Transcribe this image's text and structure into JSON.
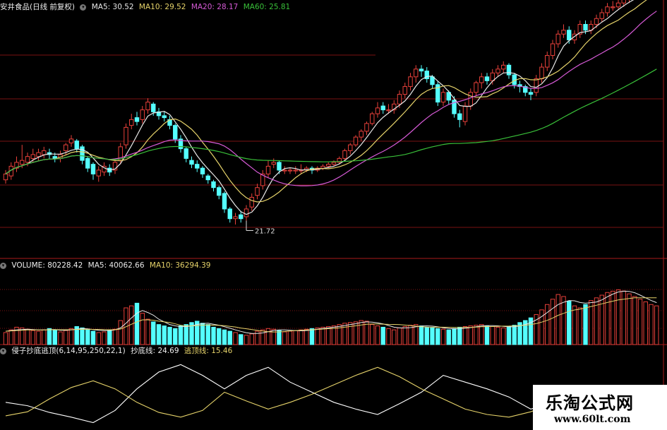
{
  "colors": {
    "up": "#e8403a",
    "down": "#54ffff",
    "ma5": "#e8e8e8",
    "ma10": "#e6d36a",
    "ma20": "#d65ad6",
    "ma60": "#39c039",
    "grid": "#7a1212",
    "frame": "#aa1a1a",
    "osc1": "#ffffff",
    "osc2": "#e6d36a"
  },
  "header_price": {
    "title": "安井食品(日线 前复权)",
    "ma5": "MA5: 30.52",
    "ma10": "MA10: 29.52",
    "ma20": "MA20: 28.17",
    "ma60": "MA60: 25.81"
  },
  "header_volume": {
    "volume": "VOLUME: 80228.42",
    "ma5": "MA5: 40062.66",
    "ma10": "MA10: 36294.39"
  },
  "header_indicator": {
    "title": "侵子抄底逃顶(6,14,95,250,22,1)",
    "buy": "抄底线: 24.69",
    "sell": "逃顶线: 15.46"
  },
  "watermark": {
    "title": "乐淘公式网",
    "url": "www.60lt.com"
  },
  "chart_data": [
    {
      "type": "candlestick",
      "panel": "price",
      "title": "安井食品(日线 前复权)",
      "annotation": "21.72",
      "annotation_x": 44,
      "ylim": [
        20.5,
        33
      ],
      "x": [
        0,
        1,
        2,
        3,
        4,
        5,
        6,
        7,
        8,
        9,
        10,
        11,
        12,
        13,
        14,
        15,
        16,
        17,
        18,
        19,
        20,
        21,
        22,
        23,
        24,
        25,
        26,
        27,
        28,
        29,
        30,
        31,
        32,
        33,
        34,
        35,
        36,
        37,
        38,
        39,
        40,
        41,
        42,
        43,
        44,
        45,
        46,
        47,
        48,
        49,
        50,
        51,
        52,
        53,
        54,
        55,
        56,
        57,
        58,
        59,
        60,
        61,
        62,
        63,
        64,
        65,
        66,
        67,
        68,
        69,
        70,
        71,
        72,
        73,
        74,
        75,
        76,
        77,
        78,
        79,
        80,
        81,
        82,
        83,
        84,
        85,
        86,
        87,
        88,
        89,
        90,
        91,
        92,
        93,
        94,
        95,
        96,
        97,
        98,
        99,
        100,
        101,
        102,
        103,
        104,
        105,
        106,
        107,
        108,
        109,
        110,
        111,
        112,
        113,
        114,
        115,
        116,
        117,
        118,
        119
      ],
      "open": [
        24.4,
        24.6,
        25.0,
        25.2,
        25.3,
        25.5,
        25.6,
        25.7,
        25.8,
        25.6,
        25.5,
        25.9,
        26.3,
        26.4,
        26.1,
        25.5,
        25.2,
        24.6,
        24.8,
        25.0,
        24.9,
        25.4,
        26.2,
        27.2,
        27.6,
        27.5,
        28.0,
        28.3,
        27.9,
        27.7,
        27.5,
        27.2,
        26.5,
        26.0,
        25.4,
        25.2,
        25.0,
        24.6,
        24.3,
        24.0,
        23.7,
        22.9,
        22.4,
        22.6,
        22.5,
        23.0,
        23.6,
        24.1,
        24.7,
        25.2,
        25.3,
        24.9,
        24.9,
        24.9,
        24.9,
        24.9,
        25.0,
        24.9,
        25.0,
        25.1,
        25.2,
        25.3,
        25.5,
        25.9,
        26.2,
        26.6,
        26.9,
        27.3,
        27.8,
        28.2,
        28.0,
        28.0,
        28.3,
        28.8,
        29.2,
        29.7,
        30.1,
        30.0,
        29.7,
        29.3,
        28.4,
        28.9,
        28.5,
        27.8,
        27.4,
        28.2,
        28.9,
        29.4,
        29.7,
        29.5,
        29.9,
        30.1,
        30.3,
        29.8,
        29.3,
        29.2,
        28.9,
        28.9,
        29.6,
        30.2,
        30.8,
        31.4,
        31.9,
        32.1,
        31.6,
        31.9,
        32.4,
        32.1,
        32.4,
        32.7,
        33.0,
        33.3,
        33.3,
        33.5,
        33.7,
        33.9,
        34.1,
        34.3,
        34.5,
        34.7
      ],
      "close": [
        24.7,
        25.1,
        25.3,
        25.4,
        25.6,
        25.7,
        25.8,
        25.9,
        25.7,
        25.5,
        25.7,
        26.2,
        26.5,
        26.0,
        25.4,
        25.0,
        24.7,
        24.9,
        25.1,
        24.8,
        25.3,
        26.1,
        27.1,
        27.5,
        27.4,
        28.0,
        28.4,
        27.9,
        27.7,
        27.6,
        27.2,
        26.5,
        26.0,
        25.5,
        25.2,
        25.0,
        24.7,
        24.4,
        24.0,
        23.6,
        22.9,
        22.4,
        22.5,
        22.4,
        22.9,
        23.5,
        24.0,
        24.7,
        25.1,
        25.3,
        24.9,
        24.9,
        24.9,
        24.9,
        24.9,
        25.0,
        24.9,
        25.0,
        25.1,
        25.2,
        25.3,
        25.5,
        25.9,
        26.2,
        26.6,
        26.9,
        27.3,
        27.8,
        28.1,
        28.0,
        28.0,
        28.3,
        28.8,
        29.2,
        29.7,
        30.1,
        30.0,
        29.6,
        29.3,
        28.4,
        28.9,
        28.5,
        27.8,
        27.5,
        28.2,
        28.9,
        29.4,
        29.7,
        29.5,
        29.9,
        30.1,
        30.3,
        29.8,
        29.3,
        29.2,
        28.9,
        28.8,
        29.6,
        30.2,
        30.8,
        31.4,
        31.9,
        32.1,
        31.6,
        31.9,
        32.4,
        32.1,
        32.4,
        32.7,
        33.0,
        33.3,
        33.3,
        33.5,
        33.7,
        33.9,
        34.1,
        34.3,
        34.5,
        34.7,
        34.9
      ],
      "high": [
        24.9,
        25.3,
        25.6,
        26.2,
        25.8,
        26.0,
        26.0,
        26.1,
        26.0,
        25.8,
        25.9,
        26.3,
        26.7,
        26.5,
        26.2,
        25.6,
        25.3,
        25.1,
        25.3,
        25.2,
        25.5,
        26.3,
        27.3,
        27.8,
        27.9,
        28.2,
        28.6,
        28.4,
        28.1,
        27.9,
        27.7,
        27.3,
        26.7,
        26.1,
        25.6,
        25.4,
        25.1,
        24.7,
        24.4,
        24.1,
        23.8,
        23.0,
        22.7,
        22.8,
        23.1,
        23.7,
        24.2,
        24.9,
        25.4,
        25.5,
        25.4,
        25.1,
        25.0,
        25.1,
        25.2,
        25.1,
        25.1,
        25.1,
        25.2,
        25.3,
        25.4,
        25.6,
        26.0,
        26.3,
        26.7,
        27.0,
        27.4,
        27.9,
        28.4,
        28.4,
        28.3,
        28.5,
        29.0,
        29.4,
        29.9,
        30.3,
        30.3,
        30.2,
        29.8,
        29.5,
        29.1,
        29.0,
        28.7,
        28.0,
        28.4,
        29.1,
        29.5,
        29.9,
        29.9,
        30.1,
        30.3,
        30.5,
        30.4,
        29.9,
        29.5,
        29.3,
        29.1,
        29.8,
        30.4,
        31.0,
        31.6,
        32.1,
        32.4,
        32.3,
        32.1,
        32.6,
        32.6,
        32.6,
        32.9,
        33.2,
        33.5,
        33.6,
        33.7,
        33.9,
        34.1,
        34.3,
        34.5,
        34.7,
        34.9,
        35.1
      ],
      "low": [
        24.2,
        24.4,
        24.8,
        25.0,
        25.1,
        25.3,
        25.4,
        25.5,
        25.5,
        25.3,
        25.3,
        25.7,
        26.1,
        25.8,
        25.2,
        24.8,
        24.4,
        24.3,
        24.6,
        24.6,
        24.7,
        25.2,
        26.0,
        27.0,
        27.2,
        27.3,
        27.8,
        27.7,
        27.5,
        27.4,
        27.0,
        26.3,
        25.8,
        25.3,
        25.0,
        24.8,
        24.5,
        24.2,
        23.8,
        23.4,
        22.7,
        22.2,
        22.1,
        22.2,
        22.3,
        22.8,
        23.4,
        23.9,
        24.5,
        25.0,
        24.7,
        24.7,
        24.7,
        24.7,
        24.7,
        24.8,
        24.7,
        24.8,
        24.9,
        25.0,
        25.1,
        25.2,
        25.4,
        25.7,
        26.1,
        26.4,
        26.7,
        27.2,
        27.6,
        27.8,
        27.8,
        27.8,
        28.1,
        28.6,
        29.0,
        29.4,
        29.7,
        29.4,
        29.1,
        28.2,
        28.2,
        28.3,
        27.6,
        27.1,
        27.2,
        28.0,
        28.7,
        29.1,
        29.3,
        29.3,
        29.7,
        29.9,
        29.6,
        29.1,
        28.9,
        28.7,
        28.5,
        28.7,
        29.4,
        30.0,
        30.6,
        31.2,
        31.7,
        31.4,
        31.4,
        31.7,
        31.9,
        31.9,
        32.2,
        32.5,
        32.8,
        33.1,
        33.2,
        33.3,
        33.5,
        33.7,
        33.9,
        34.1,
        34.3,
        34.5
      ],
      "series_names": [
        "MA5",
        "MA10",
        "MA20",
        "MA60"
      ]
    },
    {
      "type": "bar",
      "panel": "volume",
      "series_names": [
        "VOLUME",
        "MA5",
        "MA10"
      ],
      "ylim": [
        0,
        110000
      ],
      "values": [
        18000,
        22000,
        26000,
        25000,
        23000,
        21000,
        20000,
        22000,
        24000,
        22000,
        19000,
        21000,
        24000,
        27000,
        25000,
        22000,
        20000,
        18000,
        19000,
        21000,
        23000,
        36000,
        55000,
        58000,
        62000,
        47000,
        38000,
        34000,
        30000,
        28000,
        26000,
        24000,
        28000,
        30000,
        33000,
        35000,
        32000,
        30000,
        26000,
        24000,
        22000,
        20000,
        18000,
        15000,
        14000,
        16000,
        20000,
        22000,
        24000,
        23000,
        21000,
        19000,
        20000,
        21000,
        22000,
        23000,
        24000,
        25000,
        26000,
        27000,
        28000,
        30000,
        32000,
        33000,
        34000,
        36000,
        35000,
        30000,
        28000,
        26000,
        24000,
        22000,
        25000,
        27000,
        29000,
        30000,
        28000,
        26000,
        25000,
        24000,
        23000,
        22000,
        24000,
        26000,
        27000,
        28000,
        29000,
        30000,
        28000,
        27000,
        26000,
        25000,
        27000,
        29000,
        33000,
        36000,
        40000,
        45000,
        52000,
        60000,
        68000,
        75000,
        72000,
        65000,
        58000,
        55000,
        60000,
        66000,
        70000,
        74000,
        78000,
        80000,
        82000,
        80228,
        76000,
        72000,
        68000,
        64000,
        60000,
        58000
      ],
      "ma5": [
        20000,
        21000,
        22000,
        22500,
        23000,
        22500,
        22000,
        22000,
        22500,
        22500,
        21500,
        21500,
        22000,
        23000,
        24000,
        23500,
        22500,
        21500,
        21000,
        21000,
        22000,
        25000,
        32000,
        40000,
        47000,
        51000,
        48000,
        44000,
        38000,
        34000,
        30000,
        28000,
        27000,
        27000,
        28000,
        30000,
        31500,
        32000,
        30500,
        29000,
        26800,
        24400,
        22000,
        19800,
        17800,
        16600,
        16600,
        17400,
        19200,
        21000,
        22000,
        22000,
        21400,
        20800,
        20600,
        21000,
        22000,
        23000,
        24000,
        25000,
        26000,
        27200,
        28600,
        30000,
        31200,
        33000,
        34000,
        33600,
        32600,
        31000,
        28600,
        26000,
        25000,
        25000,
        25400,
        26600,
        27800,
        28000,
        27600,
        26600,
        25200,
        24000,
        23600,
        23800,
        24400,
        25400,
        26800,
        28000,
        28400,
        28400,
        28000,
        27200,
        26600,
        26800,
        28000,
        30000,
        33000,
        37000,
        42000,
        48000,
        54000,
        60000,
        63400,
        66000,
        65600,
        63000,
        62000,
        62800,
        63800,
        67000,
        71600,
        75600,
        78800,
        80000,
        79600,
        77600,
        74000,
        70000,
        66000,
        62800
      ],
      "ma10": [
        20000,
        20500,
        21000,
        21500,
        22000,
        22000,
        22000,
        22000,
        22200,
        22400,
        22200,
        22200,
        22300,
        22600,
        22800,
        22800,
        22700,
        22600,
        22300,
        22200,
        22200,
        23300,
        26700,
        30500,
        34000,
        37000,
        37000,
        36500,
        35000,
        34000,
        33000,
        31000,
        29000,
        28000,
        28000,
        28500,
        29000,
        29500,
        29000,
        28900,
        28300,
        27200,
        26300,
        24700,
        23700,
        22400,
        21300,
        20200,
        19300,
        18800,
        19000,
        19600,
        20300,
        21000,
        21500,
        22000,
        22200,
        22600,
        23300,
        23800,
        24200,
        25000,
        26000,
        27100,
        28100,
        29400,
        30500,
        30800,
        30800,
        30600,
        30300,
        30100,
        29800,
        29200,
        28400,
        27600,
        26700,
        26100,
        26000,
        26000,
        26000,
        25900,
        25700,
        25600,
        25600,
        25800,
        26200,
        26700,
        27000,
        27000,
        27400,
        27600,
        27700,
        28000,
        28400,
        29000,
        30000,
        31400,
        33600,
        36300,
        39800,
        43900,
        46800,
        49900,
        51800,
        53000,
        55000,
        57000,
        58900,
        61000,
        63000,
        65000,
        66800,
        68000,
        69000,
        70000,
        70000,
        70000,
        70000,
        70000
      ]
    },
    {
      "type": "line",
      "panel": "indicator",
      "title": "侵子抄底逃顶(6,14,95,250,22,1)",
      "series_names": [
        "抄底线",
        "逃顶线"
      ],
      "ylim": [
        0,
        110
      ],
      "x": [
        0,
        4,
        8,
        12,
        16,
        20,
        24,
        28,
        32,
        36,
        40,
        44,
        48,
        52,
        56,
        60,
        64,
        68,
        72,
        76,
        80,
        84,
        88,
        92,
        96,
        100,
        104,
        108,
        112,
        116,
        119
      ],
      "buy_line": [
        40,
        35,
        25,
        18,
        10,
        28,
        60,
        85,
        96,
        80,
        60,
        80,
        92,
        70,
        55,
        40,
        30,
        22,
        38,
        55,
        80,
        70,
        60,
        48,
        30,
        40,
        52,
        60,
        44,
        36,
        24.69
      ],
      "sell_line": [
        20,
        26,
        45,
        62,
        72,
        60,
        40,
        25,
        18,
        28,
        55,
        42,
        30,
        40,
        52,
        66,
        80,
        92,
        78,
        60,
        45,
        30,
        22,
        18,
        26,
        38,
        28,
        20,
        14,
        20,
        15.46
      ]
    }
  ]
}
